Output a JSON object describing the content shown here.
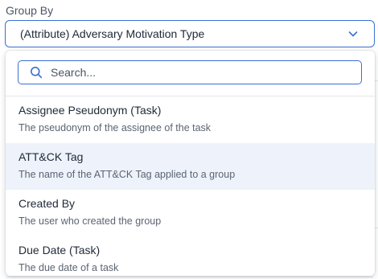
{
  "group_by": {
    "label": "Group By",
    "selected_value": "(Attribute) Adversary Motivation Type",
    "chevron_icon": "chevron-down-icon"
  },
  "dropdown": {
    "search": {
      "placeholder": "Search...",
      "icon": "search-icon"
    },
    "options": [
      {
        "title": "Assignee Pseudonym (Task)",
        "description": "The pseudonym of the assignee of the task",
        "highlighted": false
      },
      {
        "title": "ATT&CK Tag",
        "description": "The name of the ATT&CK Tag applied to a group",
        "highlighted": true
      },
      {
        "title": "Created By",
        "description": "The user who created the group",
        "highlighted": false
      },
      {
        "title": "Due Date (Task)",
        "description": "The due date of a task",
        "highlighted": false
      }
    ]
  },
  "colors": {
    "accent": "#3b6fd4",
    "highlight_bg": "#eef3fb"
  }
}
